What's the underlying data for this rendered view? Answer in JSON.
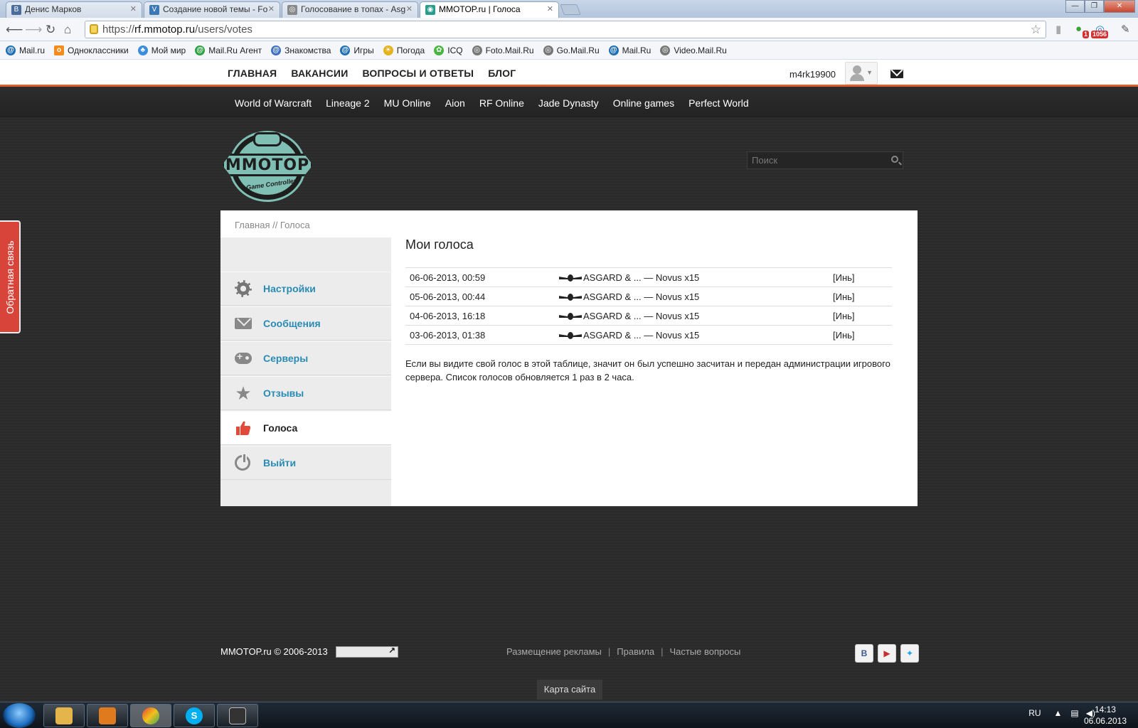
{
  "browser": {
    "tabs": [
      {
        "title": "Денис Марков",
        "favicon": "vk-icon",
        "color": "#4a6d9c"
      },
      {
        "title": "Создание новой темы - Fo",
        "favicon": "forum-icon",
        "color": "#3b78b4"
      },
      {
        "title": "Голосование в топах - Asg",
        "favicon": "globe-icon",
        "color": "#888888"
      },
      {
        "title": "MMOTOP.ru | Голоса",
        "favicon": "mmotop-icon",
        "color": "#2a9d8f"
      }
    ],
    "url_scheme": "https://",
    "url_host": "rf.mmotop.ru",
    "url_path": "/users/votes",
    "badges": {
      "ext1": "1",
      "ext2": "1056"
    },
    "bookmarks": [
      {
        "label": "Mail.ru",
        "color": "#1f6fb2"
      },
      {
        "label": "Одноклассники",
        "color": "#f28c1e"
      },
      {
        "label": "Мой мир",
        "color": "#3c8ddb"
      },
      {
        "label": "Mail.Ru Агент",
        "color": "#2ea043"
      },
      {
        "label": "Знакомства",
        "color": "#3c6fbf"
      },
      {
        "label": "Игры",
        "color": "#1f6fb2"
      },
      {
        "label": "Погода",
        "color": "#e3b21c"
      },
      {
        "label": "ICQ",
        "color": "#4bb543"
      },
      {
        "label": "Foto.Mail.Ru",
        "color": "#777777"
      },
      {
        "label": "Go.Mail.Ru",
        "color": "#777777"
      },
      {
        "label": "Mail.Ru",
        "color": "#1f6fb2"
      },
      {
        "label": "Video.Mail.Ru",
        "color": "#777777"
      }
    ]
  },
  "site": {
    "top_nav": [
      "ГЛАВНАЯ",
      "ВАКАНСИИ",
      "ВОПРОСЫ И ОТВЕТЫ",
      "БЛОГ"
    ],
    "username": "m4rk19900",
    "game_nav": [
      "World of Warcraft",
      "Lineage 2",
      "MU Online",
      "Aion",
      "RF Online",
      "Jade Dynasty",
      "Online games",
      "Perfect World"
    ],
    "logo_text": "MMOTOP",
    "logo_tagline": "Game Controller",
    "search_placeholder": "Поиск",
    "feedback_label": "Обратная связь",
    "accent_color": "#e05a2a"
  },
  "main": {
    "breadcrumb": "Главная // Голоса",
    "sidebar": [
      {
        "label": "Настройки",
        "icon": "gear-icon",
        "active": false
      },
      {
        "label": "Сообщения",
        "icon": "envelope-icon",
        "active": false
      },
      {
        "label": "Серверы",
        "icon": "gamepad-icon",
        "active": false
      },
      {
        "label": "Отзывы",
        "icon": "star-icon",
        "active": false
      },
      {
        "label": "Голоса",
        "icon": "thumbs-up-icon",
        "active": true
      },
      {
        "label": "Выйти",
        "icon": "power-icon",
        "active": false
      }
    ],
    "title": "Мои голоса",
    "votes": [
      {
        "date": "06-06-2013, 00:59",
        "server": "ASGARD & ... — Novus x15",
        "realm": "[Инь]"
      },
      {
        "date": "05-06-2013, 00:44",
        "server": "ASGARD & ... — Novus x15",
        "realm": "[Инь]"
      },
      {
        "date": "04-06-2013, 16:18",
        "server": "ASGARD & ... — Novus x15",
        "realm": "[Инь]"
      },
      {
        "date": "03-06-2013, 01:38",
        "server": "ASGARD & ... — Novus x15",
        "realm": "[Инь]"
      }
    ],
    "note": "Если вы видите свой голос в этой таблице, значит он был успешно засчитан и передан администрации игрового сервера. Список голосов обновляется 1 раз в 2 часа."
  },
  "footer": {
    "copyright": "MMOTOP.ru © 2006-2013",
    "links": [
      "Размещение рекламы",
      "Правила",
      "Частые вопросы"
    ],
    "sitemap": "Карта сайта",
    "social": [
      "vk-icon",
      "youtube-icon",
      "twitter-icon"
    ]
  },
  "taskbar": {
    "lang": "RU",
    "time": "14:13",
    "date": "06.06.2013"
  }
}
